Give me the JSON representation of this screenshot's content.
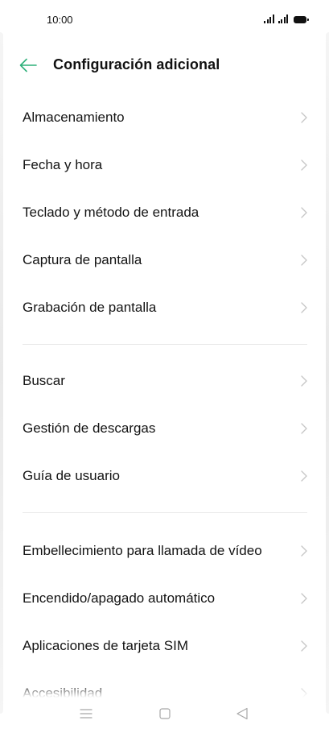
{
  "status_bar": {
    "time": "10:00",
    "icons": [
      "signal-icon",
      "signal-icon",
      "battery-icon"
    ]
  },
  "header": {
    "back_icon": "back-arrow-icon",
    "title": "Configuración adicional"
  },
  "groups": [
    {
      "items": [
        {
          "label": "Almacenamiento"
        },
        {
          "label": "Fecha y hora"
        },
        {
          "label": "Teclado y método de entrada"
        },
        {
          "label": "Captura de pantalla"
        },
        {
          "label": "Grabación de pantalla"
        }
      ]
    },
    {
      "items": [
        {
          "label": "Buscar"
        },
        {
          "label": "Gestión de descargas"
        },
        {
          "label": "Guía de usuario"
        }
      ]
    },
    {
      "items": [
        {
          "label": "Embellecimiento para llamada de vídeo"
        },
        {
          "label": "Encendido/apagado automático"
        },
        {
          "label": "Aplicaciones de tarjeta SIM"
        },
        {
          "label": "Accesibilidad"
        }
      ]
    }
  ],
  "nav_bar": {
    "buttons": [
      "menu-icon",
      "home-icon",
      "back-triangle-icon"
    ]
  },
  "colors": {
    "accent": "#2fb07a",
    "text": "#141414",
    "chevron": "#c6c6c6",
    "divider": "#e8e8e8",
    "nav_icon": "#a8a8a8"
  }
}
